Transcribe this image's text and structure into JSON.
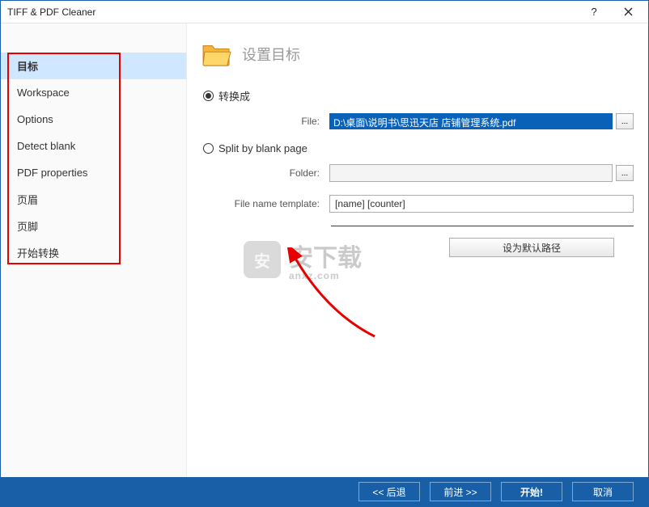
{
  "window": {
    "title": "TIFF & PDF Cleaner"
  },
  "sidebar": {
    "items": [
      {
        "label": "目标"
      },
      {
        "label": "Workspace"
      },
      {
        "label": "Options"
      },
      {
        "label": "Detect blank"
      },
      {
        "label": "PDF properties"
      },
      {
        "label": "页眉"
      },
      {
        "label": "页脚"
      },
      {
        "label": "开始转换"
      }
    ]
  },
  "header": {
    "title": "设置目标"
  },
  "radios": {
    "convert": "转换成",
    "split": "Split by blank page"
  },
  "labels": {
    "file": "File:",
    "folder": "Folder:",
    "template": "File name template:"
  },
  "values": {
    "file_path": "D:\\桌面\\说明书\\思迅天店 店铺管理系统.pdf",
    "folder_path": "",
    "template_value": "[name] [counter]"
  },
  "buttons": {
    "browse": "...",
    "default_path": "设为默认路径",
    "back": "<<  后退",
    "next": "前进  >>",
    "start": "开始!",
    "cancel": "取消"
  },
  "watermark": {
    "main": "安下载",
    "sub": "anxz.com"
  }
}
